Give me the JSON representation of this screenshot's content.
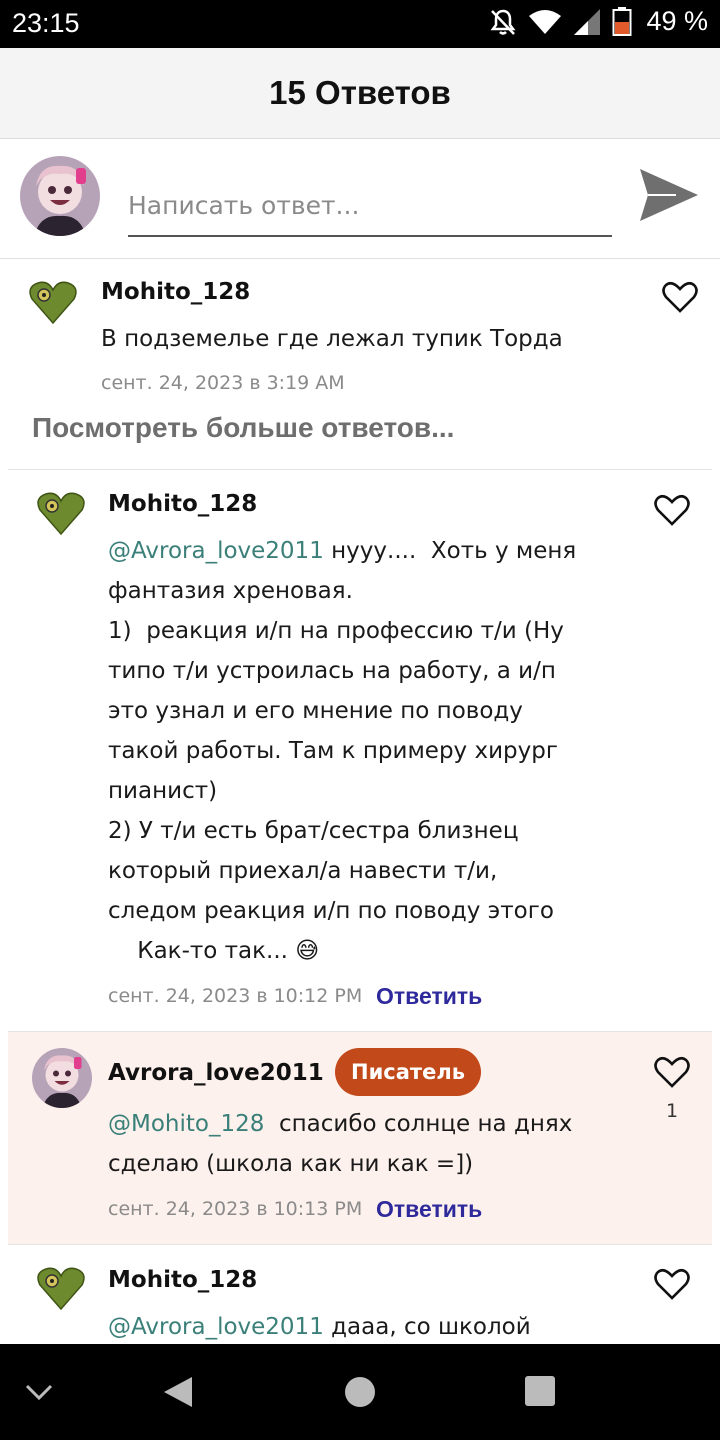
{
  "status": {
    "time": "23:15",
    "battery": "49 %"
  },
  "header": {
    "title": "15 Ответов"
  },
  "compose": {
    "placeholder": "Написать ответ..."
  },
  "comments": [
    {
      "author": "Mohito_128",
      "text": "В подземелье где лежал тупик Торда",
      "date": "сент. 24, 2023 в 3:19 AM"
    },
    {
      "author": "Mohito_128",
      "mention": "@Avrora_love2011",
      "line1": " нууу....  Хоть у меня",
      "rest": "фантазия хреновая.\n1)  реакция и/п на профессию т/и (Ну\nтипо т/и устроилась на работу, а и/п\nэто узнал и его мнение по поводу\nтакой работы. Там к примеру хирург\nпианист)\n2) У т/и есть брат/сестра близнец\nкоторый приехал/а навести т/и,\nследом реакция и/п по поводу этого\n    Как-то так... 😅",
      "date": "сент. 24, 2023 в 10:12 PM",
      "reply": "Ответить"
    },
    {
      "author": "Avrora_love2011",
      "badge": "Писатель",
      "mention": "@Mohito_128",
      "line1": "  спасибо солнце на днях",
      "rest": "сделаю (школа как ни как =])",
      "date": "сент. 24, 2023 в 10:13 PM",
      "reply": "Ответить",
      "likes": "1"
    },
    {
      "author": "Mohito_128",
      "mention": "@Avrora_love2011",
      "line1": " дааа, со школой"
    }
  ],
  "more_replies": "Посмотреть больше ответов...",
  "colors": {
    "mention": "#3b7f79",
    "reply_link": "#2f2a9c",
    "badge": "#c2491a",
    "highlight": "#fdf1ed"
  },
  "icons": [
    "mute-icon",
    "wifi-icon",
    "signal-icon",
    "battery-icon",
    "send-icon",
    "heart-icon",
    "back-icon",
    "home-icon",
    "recents-icon",
    "chevron-down-icon"
  ]
}
